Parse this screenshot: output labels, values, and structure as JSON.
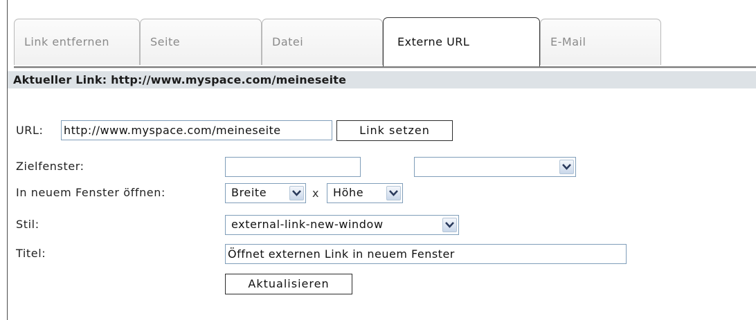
{
  "tabs": [
    {
      "label": "Link entfernen"
    },
    {
      "label": "Seite"
    },
    {
      "label": "Datei"
    },
    {
      "label": "Externe URL",
      "active": true
    },
    {
      "label": "E-Mail"
    }
  ],
  "current_link": {
    "text": "Aktueller Link: http://www.myspace.com/meineseite"
  },
  "form": {
    "url_label": "URL:",
    "url_value": "http://www.myspace.com/meineseite",
    "set_link_button": "Link setzen",
    "target_label": "Zielfenster:",
    "target_value": "",
    "target_select_value": "",
    "new_window_label": "In neuem Fenster öffnen:",
    "width_select_value": "Breite",
    "times": "x",
    "height_select_value": "Höhe",
    "style_label": "Stil:",
    "style_select_value": "external-link-new-window",
    "title_label": "Titel:",
    "title_value": "Öffnet externen Link in neuem Fenster",
    "update_button": "Aktualisieren"
  },
  "colors": {
    "current_bar_bg": "#dde2e6",
    "field_border": "#7f9db9",
    "tab_inactive_text": "#8a8a8a"
  }
}
